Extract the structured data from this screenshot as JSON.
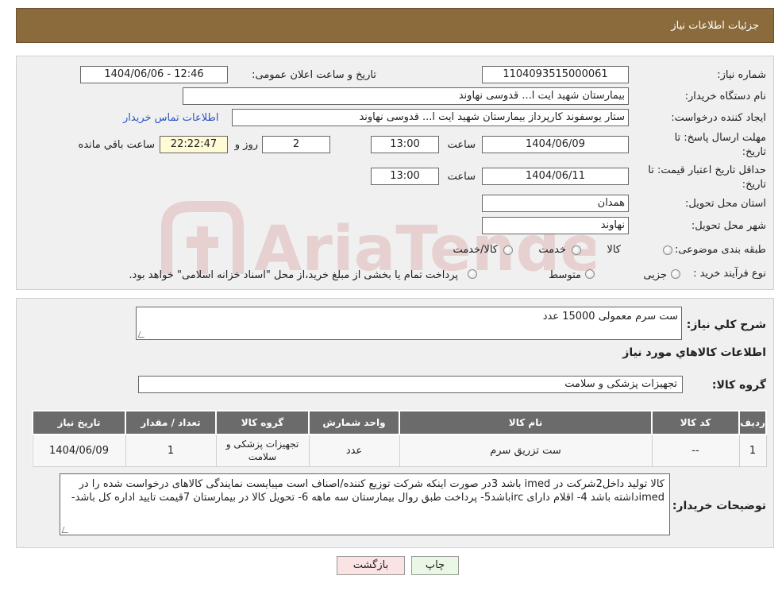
{
  "header": {
    "title": "جزئیات اطلاعات نیاز"
  },
  "form": {
    "need_number_label": "شماره نیاز:",
    "need_number": "1104093515000061",
    "announce_label": "تاریخ و ساعت اعلان عمومی:",
    "announce_value": "1404/06/06 - 12:46",
    "buyer_org_label": "نام دستگاه خریدار:",
    "buyer_org": "بیمارستان شهید ایت ا... قدوسی نهاوند",
    "creator_label": "ایجاد کننده درخواست:",
    "creator": "ستار یوسفوند کارپرداز بیمارستان شهید ایت ا... قدوسی نهاوند",
    "contact_link": "اطلاعات تماس خریدار",
    "deadline_label_1": "مهلت ارسال پاسخ: تا",
    "deadline_label_2": "تاریخ:",
    "deadline_date": "1404/06/09",
    "time_label": "ساعت",
    "deadline_time": "13:00",
    "days_value": "2",
    "days_label": "روز و",
    "remaining_value": "22:22:47",
    "remaining_label": "ساعت باقي مانده",
    "validity_label_1": "حداقل تاریخ اعتبار قیمت: تا",
    "validity_label_2": "تاریخ:",
    "validity_date": "1404/06/11",
    "validity_time": "13:00",
    "province_label": "استان محل تحویل:",
    "province": "همدان",
    "city_label": "شهر محل تحویل:",
    "city": "نهاوند",
    "category_label": "طبقه بندی موضوعی:",
    "category_options": [
      "کالا",
      "خدمت",
      "کالا/خدمت"
    ],
    "process_label": "نوع فرآیند خرید :",
    "process_options": [
      "جزیی",
      "متوسط"
    ],
    "process_note": "پرداخت تمام یا بخشی از مبلغ خرید،از محل \"اسناد خزانه اسلامی\" خواهد بود."
  },
  "summary": {
    "general_desc_label": "شرح کلي نياز:",
    "general_desc": "ست سرم معمولی 15000 عدد",
    "goods_info_title": "اطلاعات کالاهاي مورد نياز",
    "goods_group_label": "گروه کالا:",
    "goods_group": "تجهیزات پزشکی و سلامت"
  },
  "table": {
    "headers": [
      "ردیف",
      "کد کالا",
      "نام کالا",
      "واحد شمارش",
      "گروه کالا",
      "تعداد / مقدار",
      "تاریخ نیاز"
    ],
    "rows": [
      {
        "row": "1",
        "code": "--",
        "name": "ست تزریق سرم",
        "unit": "عدد",
        "group": "تجهیزات پزشکی و سلامت",
        "qty": "1",
        "date": "1404/06/09"
      }
    ]
  },
  "notes": {
    "label": "توضیحات خریدار:",
    "text": "کالا تولید داخل2شرکت در imed باشد 3در صورت اینکه شرکت توزیع کننده/اصناف است میبایست نمایندگی کالاهای درخواست شده را  در imedداشته باشد 4- اقلام دارای ircباشد5- پرداخت طبق روال بیمارستان سه ماهه 6- تحویل کالا در بیمارستان 7قیمت تایید اداره کل باشد-"
  },
  "buttons": {
    "print": "چاپ",
    "back": "بازگشت"
  },
  "watermark": {
    "text": "AriaTender.neT"
  }
}
